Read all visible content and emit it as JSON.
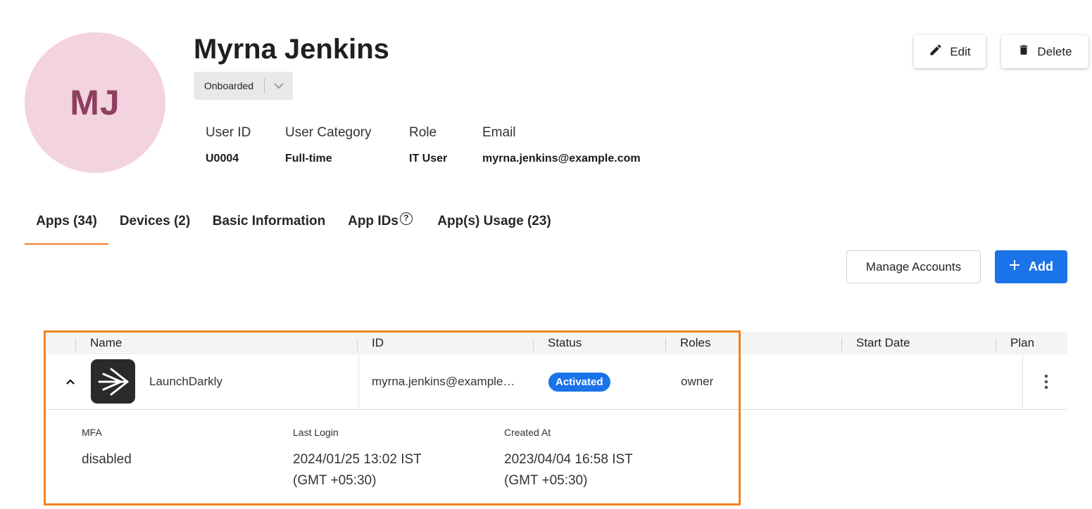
{
  "profile": {
    "initials": "MJ",
    "name": "Myrna Jenkins",
    "status_value": "Onboarded",
    "fields": {
      "user_id_label": "User ID",
      "user_id": "U0004",
      "category_label": "User Category",
      "category": "Full-time",
      "role_label": "Role",
      "role": "IT User",
      "email_label": "Email",
      "email": "myrna.jenkins@example.com"
    }
  },
  "actions": {
    "edit_label": "Edit",
    "delete_label": "Delete",
    "manage_accounts_label": "Manage Accounts",
    "add_label": "Add"
  },
  "tabs": [
    {
      "label": "Apps (34)",
      "active": true
    },
    {
      "label": "Devices (2)",
      "active": false
    },
    {
      "label": "Basic Information",
      "active": false
    },
    {
      "label": "App IDs",
      "active": false,
      "help_icon": "?"
    },
    {
      "label": "App(s) Usage (23)",
      "active": false
    }
  ],
  "table": {
    "columns": [
      "Name",
      "ID",
      "Status",
      "Roles",
      "Start Date",
      "Plan"
    ],
    "rows": [
      {
        "name": "LaunchDarkly",
        "id": "myrna.jenkins@example…",
        "status": "Activated",
        "roles": "owner",
        "start_date": "",
        "plan": "",
        "expanded": true
      }
    ],
    "details": {
      "mfa_label": "MFA",
      "mfa": "disabled",
      "last_login_label": "Last Login",
      "last_login_line1": "2024/01/25 13:02 IST",
      "last_login_line2": "(GMT +05:30)",
      "created_at_label": "Created At",
      "created_at_line1": "2023/04/04 16:58 IST",
      "created_at_line2": "(GMT +05:30)"
    }
  },
  "colors": {
    "accent": "#1a73e8",
    "tab_indicator": "#ef7b26",
    "highlight_frame": "#f08320",
    "avatar_bg": "#f3d3df",
    "avatar_text": "#8e3f5e"
  },
  "icons": {
    "edit": "pencil-icon",
    "delete": "trash-icon",
    "add": "plus-icon",
    "status_dropdown": "chevron-down-icon",
    "row_toggle": "chevron-up-icon",
    "row_menu": "more-vertical-icon",
    "app_logo": "launchdarkly-logo-icon"
  }
}
